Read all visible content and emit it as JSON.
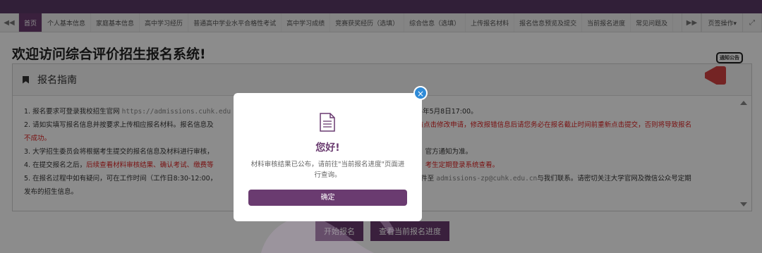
{
  "tabs": [
    "首页",
    "个人基本信息",
    "家庭基本信息",
    "高中学习经历",
    "普通高中学业水平合格性考试",
    "高中学习成绩",
    "竞赛获奖经历（选填）",
    "综合信息（选填）",
    "上传报名材料",
    "报名信息预览及提交",
    "当前报名进度",
    "常见问题及"
  ],
  "tab_ops": "页签操作▾",
  "page_title": "欢迎访问综合评价招生报名系统!",
  "panel_title": "报名指南",
  "guide": {
    "l1a": "1.  报名要求可登录我校招生官网 ",
    "l1url": "https://admissions.cuhk.edu",
    "l1b": "25年5月8日17:00。",
    "l2a": "2.  请如实填写报名信息并按要求上传相应报名材料。报名信息及",
    "l2red": "前点击修改申请，修改报错信息后请您务必在报名截止时间前重新点击提交，否则将导致报名",
    "l2red2": "不成功。",
    "l3a": "3.  大学招生委员会将根据考生提交的报名信息及材料进行审核，",
    "l3b": "官方通知为准。",
    "l4a": "4.  在提交报名之后，",
    "l4red": "后续查看材料审核结果、确认考试、缴费等",
    "l4red2": "考生定期登录系统查看。",
    "l5a": "5.  在报名过程中如有疑问，可在工作时间（工作日8:30-12:00，",
    "l5b": "送邮件至 ",
    "l5mail": "admissions-zp@cuhk.edu.cn",
    "l5c": "与我们联系。请密切关注大学官网及微信公众号定期",
    "l6": "发布的招生信息。"
  },
  "buttons": {
    "start": "开始报名",
    "progress": "查看当前报名进度"
  },
  "notice_label": "通知公告",
  "modal": {
    "title": "您好!",
    "message": "材料审核结果已公布，请前往\"当前报名进度\"页面进行查询。",
    "confirm": "确定",
    "close_symbol": "×"
  },
  "colors": {
    "primary": "#6a3b70",
    "topbar": "#5a3a66",
    "close": "#2f8bd8",
    "warning": "#d22222"
  }
}
